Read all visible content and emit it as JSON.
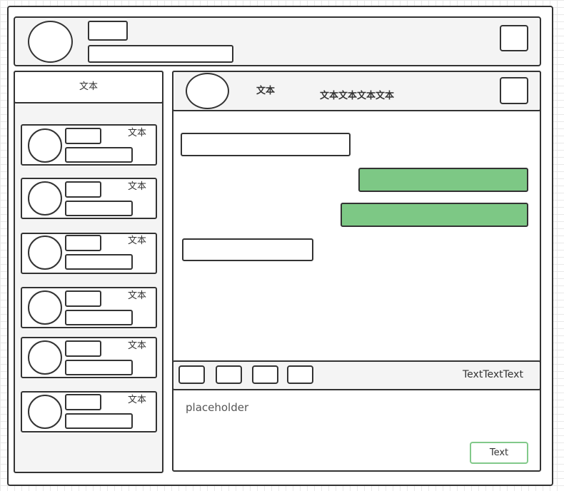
{
  "header": {},
  "sidebar": {
    "title": "文本",
    "items": [
      {
        "name": "文本"
      },
      {
        "name": "文本"
      },
      {
        "name": "文本"
      },
      {
        "name": "文本"
      },
      {
        "name": "文本"
      },
      {
        "name": "文本"
      }
    ]
  },
  "chat": {
    "title": "文本",
    "subtitle": "文本文本文本文本",
    "messages": [
      {
        "side": "left"
      },
      {
        "side": "right"
      },
      {
        "side": "right"
      },
      {
        "side": "left"
      }
    ]
  },
  "toolbar": {
    "status_text": "TextTextText"
  },
  "composer": {
    "placeholder": "placeholder",
    "send_label": "Text"
  },
  "colors": {
    "outgoing_bubble": "#7dc885",
    "send_border": "#82c98a",
    "panel_gray": "#f4f4f4"
  }
}
